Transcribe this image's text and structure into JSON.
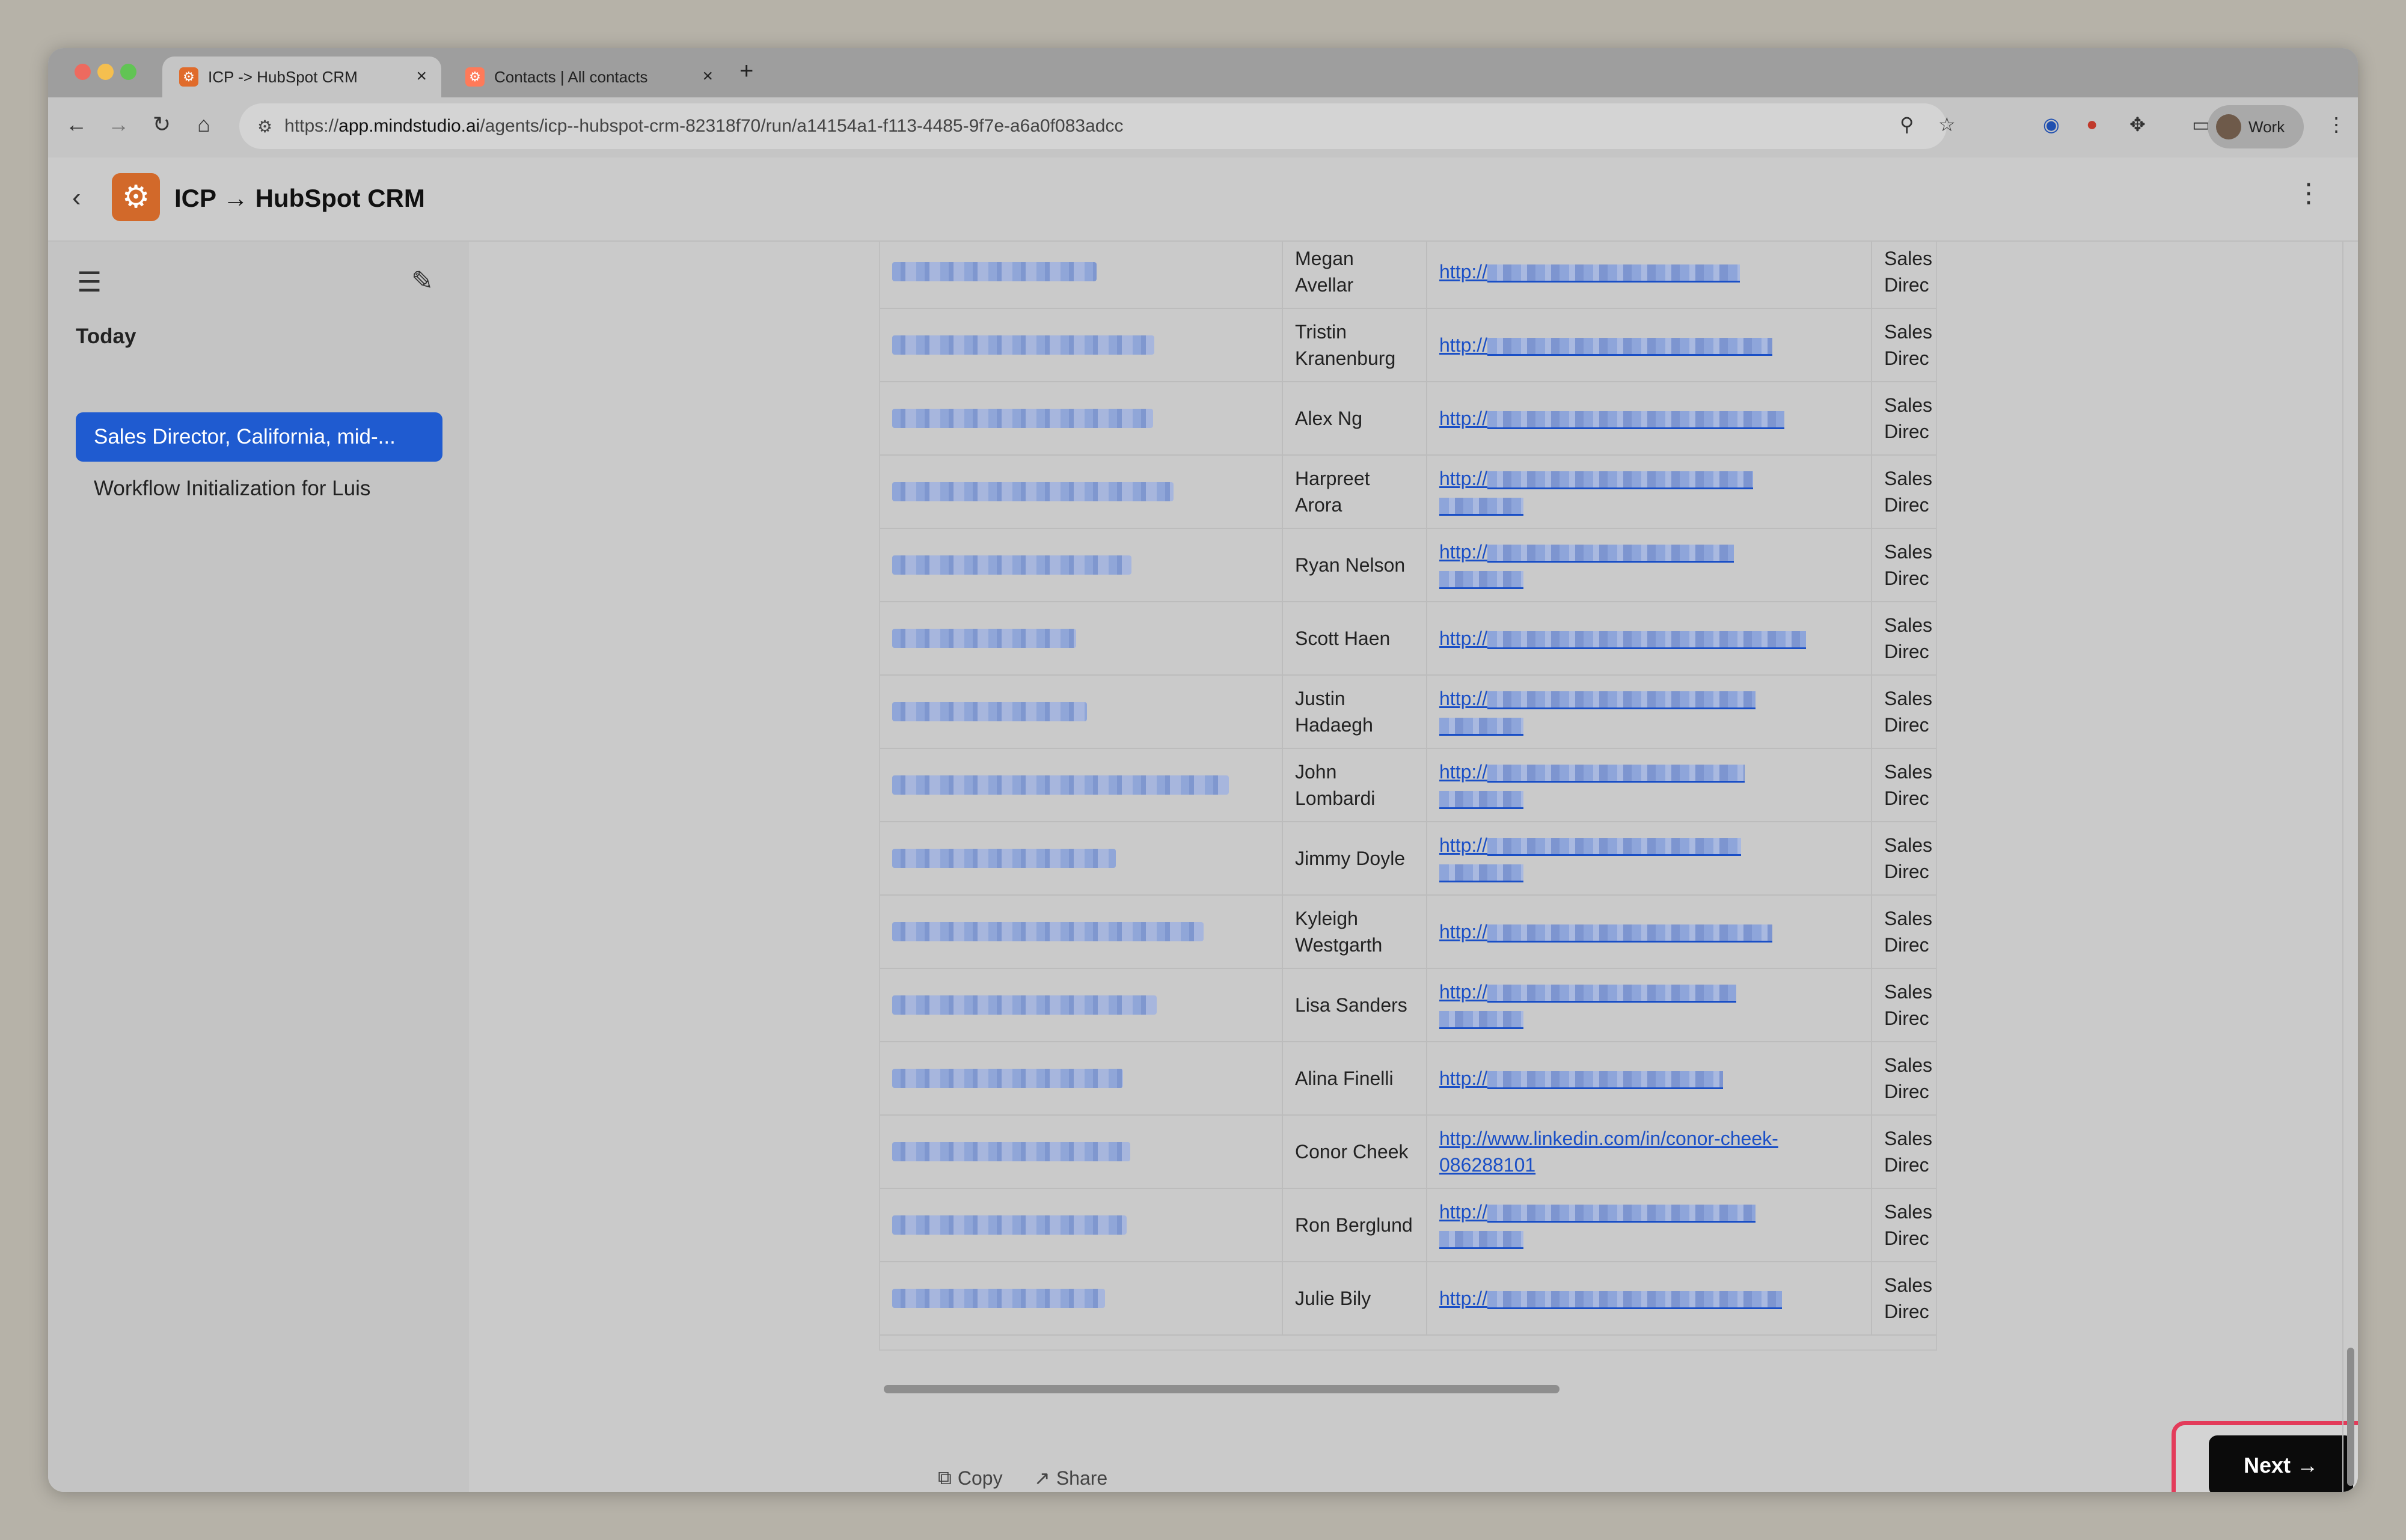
{
  "browser": {
    "tabs": [
      {
        "title": "ICP -> HubSpot CRM",
        "active": true
      },
      {
        "title": "Contacts | All contacts",
        "active": false
      }
    ],
    "url_prefix": "https://",
    "url_domain": "app.mindstudio.ai",
    "url_path": "/agents/icp--hubspot-crm-82318f70/run/a14154a1-f113-4485-9f7e-a6a0f083adcc",
    "profile_label": "Work"
  },
  "app": {
    "title": "ICP → HubSpot CRM"
  },
  "sidebar": {
    "section_label": "Today",
    "conversations": [
      {
        "label": "Sales Director, California, mid-...",
        "selected": true
      },
      {
        "label": "Workflow Initialization for Luis",
        "selected": false
      }
    ]
  },
  "table": {
    "rows": [
      {
        "name": "Megan Avellar",
        "link_visible": "http://",
        "title_cut": "Sales Direc"
      },
      {
        "name": "Tristin Kranenburg",
        "link_visible": "http://",
        "title_cut": "Sales Direc"
      },
      {
        "name": "Alex Ng",
        "link_visible": "http://",
        "title_cut": "Sales Direc"
      },
      {
        "name": "Harpreet Arora",
        "link_visible": "http://",
        "title_cut": "Sales Direc"
      },
      {
        "name": "Ryan Nelson",
        "link_visible": "http://",
        "title_cut": "Sales Direc"
      },
      {
        "name": "Scott Haen",
        "link_visible": "http://",
        "title_cut": "Sales Direc"
      },
      {
        "name": "Justin Hadaegh",
        "link_visible": "http://",
        "title_cut": "Sales Direc"
      },
      {
        "name": "John Lombardi",
        "link_visible": "http://",
        "title_cut": "Sales Direc"
      },
      {
        "name": "Jimmy Doyle",
        "link_visible": "http://",
        "title_cut": "Sales Direc"
      },
      {
        "name": "Kyleigh Westgarth",
        "link_visible": "http://",
        "title_cut": "Sales Direc"
      },
      {
        "name": "Lisa Sanders",
        "link_visible": "http://",
        "title_cut": "Sales Direc"
      },
      {
        "name": "Alina Finelli",
        "link_visible": "http://",
        "title_cut": "Sales Direc"
      },
      {
        "name": "Conor Cheek",
        "link_visible": "http://www.linkedin.com/in/conor-cheek-086288101",
        "title_cut": "Sales Direc"
      },
      {
        "name": "Ron Berglund",
        "link_visible": "http://",
        "title_cut": "Sales Direc"
      },
      {
        "name": "Julie Bily",
        "link_visible": "http://",
        "title_cut": "Sales Direc"
      }
    ]
  },
  "actions": {
    "copy_label": "Copy",
    "share_label": "Share",
    "next_label": "Next →"
  },
  "colors": {
    "accent": "#1f5bd0",
    "logo": "#d2692a",
    "highlight": "#e33b5a"
  }
}
